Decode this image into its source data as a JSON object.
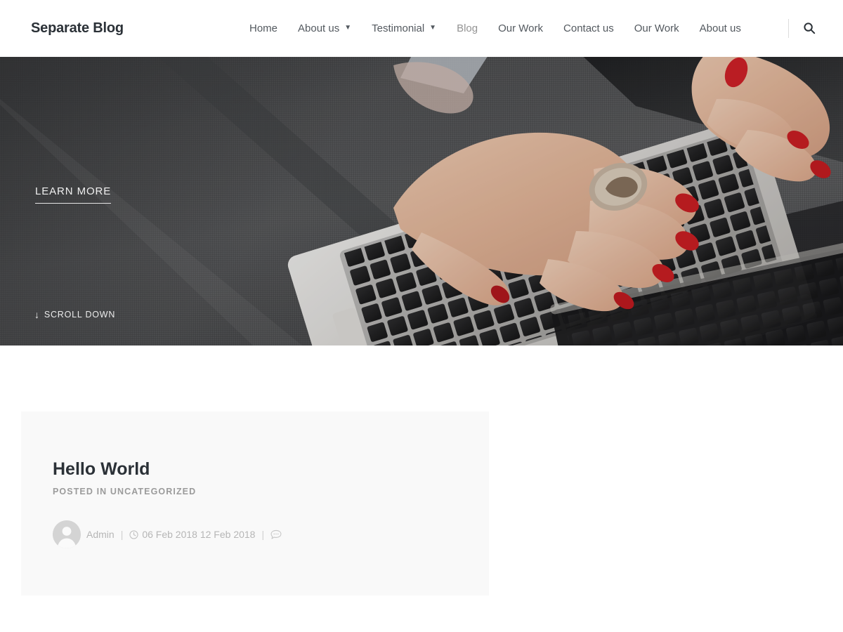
{
  "header": {
    "logo": "Separate Blog",
    "nav_items": [
      {
        "label": "Home",
        "has_caret": false,
        "active": false
      },
      {
        "label": "About us",
        "has_caret": true,
        "active": false
      },
      {
        "label": "Testimonial",
        "has_caret": true,
        "active": false
      },
      {
        "label": "Blog",
        "has_caret": false,
        "active": true
      },
      {
        "label": "Our Work",
        "has_caret": false,
        "active": false
      },
      {
        "label": "Contact us",
        "has_caret": false,
        "active": false
      },
      {
        "label": "Our Work",
        "has_caret": false,
        "active": false
      },
      {
        "label": "About us",
        "has_caret": false,
        "active": false
      }
    ],
    "caret_glyph": "▼",
    "search_icon": "search-icon"
  },
  "hero": {
    "learn_more_label": "LEARN MORE",
    "scroll_down_label": "SCROLL DOWN",
    "scroll_arrow_glyph": "↓",
    "image_description": "woman with red nail polish typing on a silver laptop resting on dark grey woven fabric"
  },
  "post": {
    "title": "Hello World",
    "category_line": "POSTED IN UNCATEGORIZED",
    "author": "Admin",
    "date": "06 Feb 2018 12 Feb 2018",
    "separator": "|",
    "clock_icon": "clock-icon",
    "comment_icon": "comment-bubble-icon",
    "avatar_icon": "default-user-avatar"
  },
  "colors": {
    "page_background": "#ffffff",
    "header_background": "#ffffff",
    "logo_text": "#2b3137",
    "nav_text": "#53595f",
    "nav_active_text": "#939393",
    "card_background": "#f9f9f9",
    "title_text": "#2b3137",
    "category_text": "#9b9b9b",
    "meta_text": "#b6b6b6",
    "hero_text": "#f0f0f0"
  }
}
